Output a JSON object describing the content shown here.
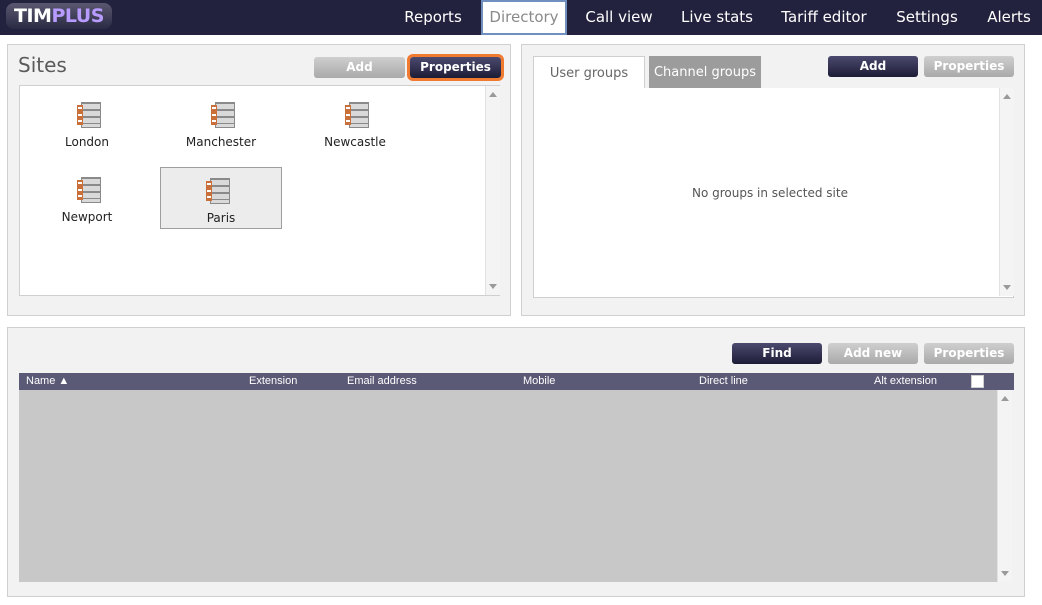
{
  "header": {
    "logo_tim": "TIM",
    "logo_plus": "PLUS",
    "nav": [
      {
        "label": "Reports"
      },
      {
        "label": "Directory",
        "active": true
      },
      {
        "label": "Call view"
      },
      {
        "label": "Live stats"
      },
      {
        "label": "Tariff editor"
      },
      {
        "label": "Settings"
      },
      {
        "label": "Alerts"
      }
    ]
  },
  "sites_panel": {
    "title": "Sites",
    "add_label": "Add",
    "properties_label": "Properties",
    "sites": [
      {
        "name": "London",
        "selected": false
      },
      {
        "name": "Manchester",
        "selected": false
      },
      {
        "name": "Newcastle",
        "selected": false
      },
      {
        "name": "Newport",
        "selected": false
      },
      {
        "name": "Paris",
        "selected": true
      }
    ]
  },
  "groups_panel": {
    "tabs": [
      {
        "label": "User groups",
        "active": true
      },
      {
        "label": "Channel groups",
        "active": false
      }
    ],
    "add_label": "Add",
    "properties_label": "Properties",
    "empty_message": "No groups in selected site"
  },
  "directory_panel": {
    "find_label": "Find",
    "add_new_label": "Add new",
    "properties_label": "Properties",
    "columns": [
      "Name ▲",
      "Extension",
      "Email address",
      "Mobile",
      "Direct line",
      "Alt extension"
    ]
  },
  "colors": {
    "nav_bg": "#23223e",
    "button_dark": "#2b2a48",
    "button_grey": "#b8b8b8",
    "highlight": "#f07a30",
    "table_header": "#5b5a76"
  }
}
